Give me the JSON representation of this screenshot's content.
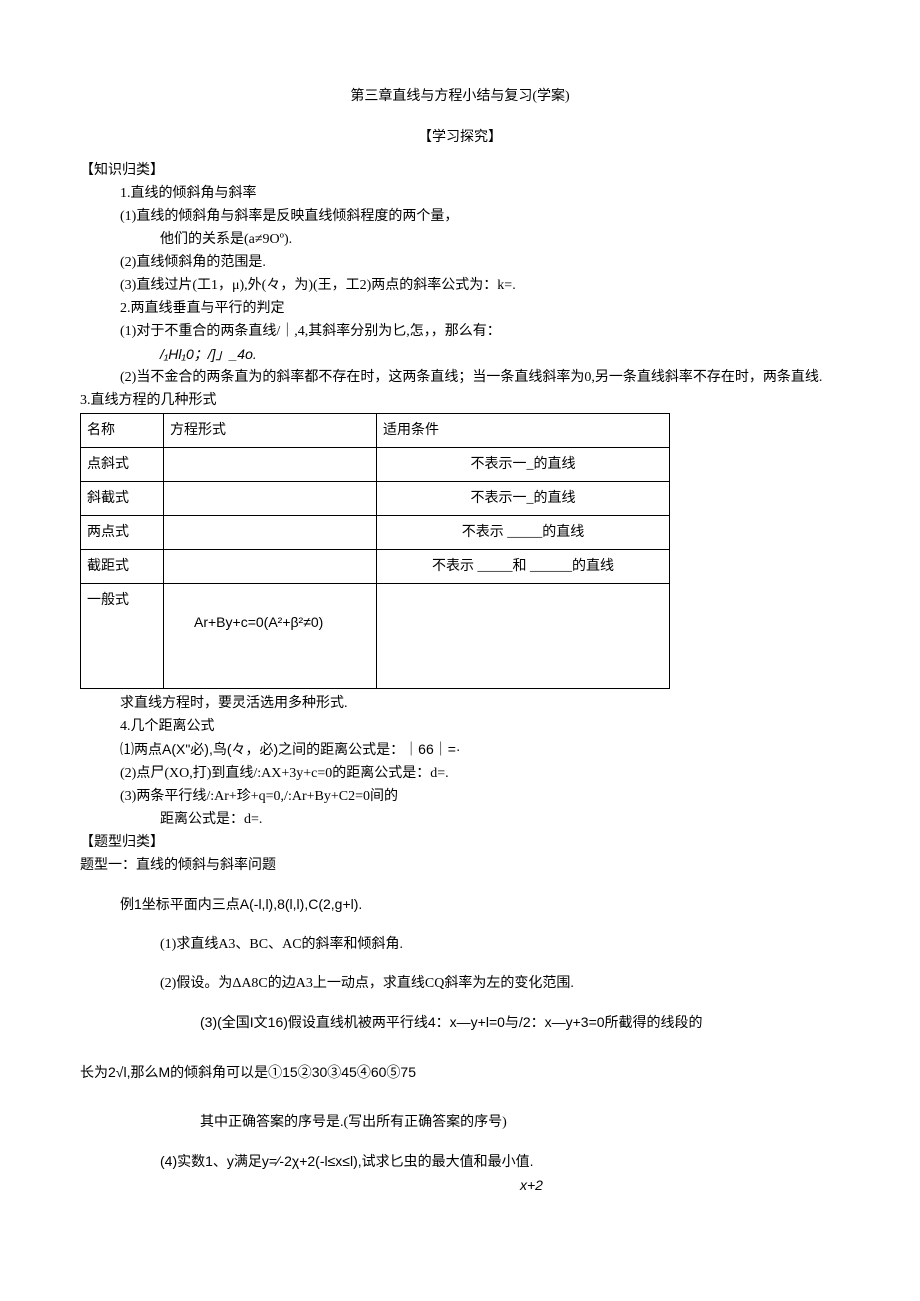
{
  "title": "第三章直线与方程小结与复习(学案)",
  "heading": "【学习探究】",
  "s1": "【知识归类】",
  "p1": "1.直线的倾斜角与斜率",
  "p1_1": "(1)直线的倾斜角与斜率是反映直线倾斜程度的两个量，",
  "p1_1b": "他们的关系是(a≠9Oº).",
  "p1_2": "(2)直线倾斜角的范围是.",
  "p1_3": "(3)直线过片(工1，μ),外(々，为)(王，工2)两点的斜率公式为：k=.",
  "p2": "2.两直线垂直与平行的判定",
  "p2_1": "(1)对于不重合的两条直线/｜,4,其斜率分别为匕,怎，，那么有：",
  "p2_1b": "/₁Hl₁0；/]」_4o.",
  "p2_2": "(2)当不金合的两条直为的斜率都不存在时，这两条直线；当一条直线斜率为0,另一条直线斜率不存在时，两条直线.",
  "p3": "3.直线方程的几种形式",
  "table": {
    "h1": "名称",
    "h2": "方程形式",
    "h3": "适用条件",
    "r1c1": "点斜式",
    "r1c3": "不表示一_的直线",
    "r2c1": "斜截式",
    "r2c3": "不表示一_的直线",
    "r3c1": "两点式",
    "r3c3": "不表示 _____的直线",
    "r4c1": "截距式",
    "r4c3": "不表示 _____和 ______的直线",
    "r5c1": "一般式",
    "r5c2": "Ar+By+c=0(A²+β²≠0)"
  },
  "p3b": "求直线方程时，要灵活选用多种形式.",
  "p4": "4.几个距离公式",
  "p4_1": "⑴两点A(X\"必),鸟(々，必)之间的距离公式是：｜66｜=·",
  "p4_2": "(2)点尸(XO,打)到直线/:AX+3y+c=0的距离公式是：d=.",
  "p4_3": "(3)两条平行线/:Ar+珍+q=0,/:Ar+By+C2=0间的",
  "p4_3b": "距离公式是：d=.",
  "s2": "【题型归类】",
  "t1": "题型一：直线的倾斜与斜率问题",
  "ex1": "例1坐标平面内三点A(-l,l),8(l,l),C(2,g+l).",
  "ex1_1": "(1)求直线A3、BC、AC的斜率和倾斜角.",
  "ex1_2": "(2)假设。为ΔA8C的边A3上一动点，求直线CQ斜率为左的变化范围.",
  "ex1_3": "(3)(全国I文16)假设直线机被两平行线4：x—y+l=0与/2：x—y+3=0所截得的线段的",
  "ex1_3b": "长为2√l,那么M的倾斜角可以是①15②30③45④60⑤75",
  "ex1_3c": "其中正确答案的序号是.(写出所有正确答案的序号)",
  "ex1_4a": "(4)实数1、y满足y=∕-2χ+2(-l≤x≤l),试求匕虫的最大值和最小值.",
  "ex1_4b": "x+2"
}
